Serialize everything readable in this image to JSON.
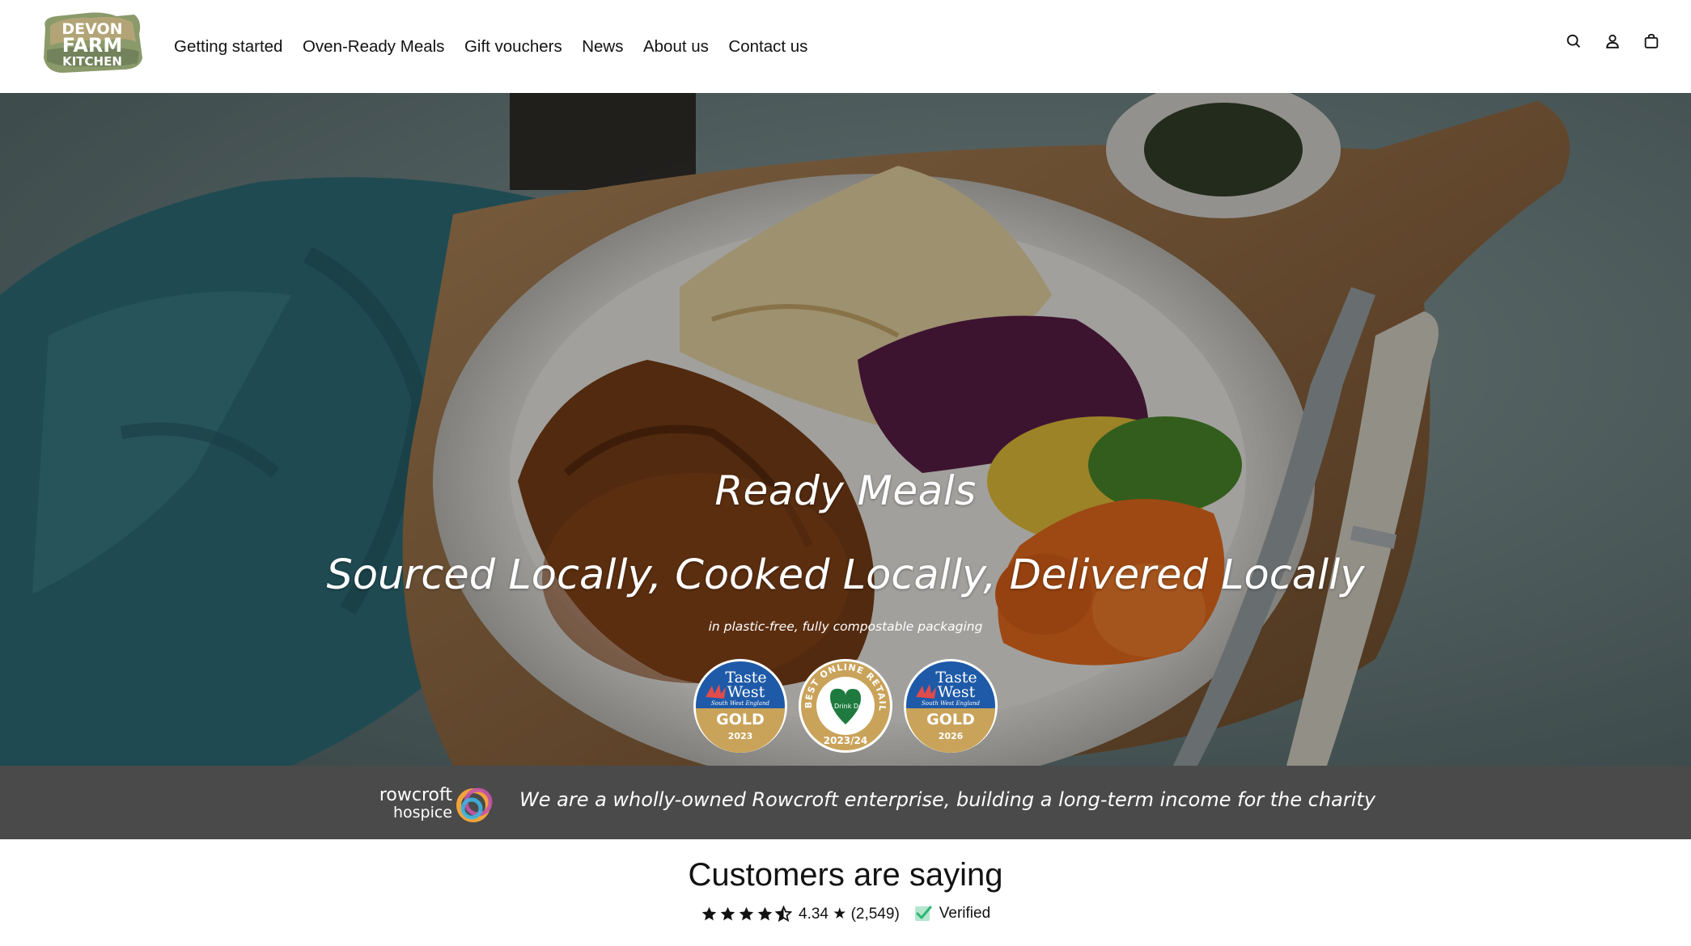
{
  "header": {
    "logo": {
      "line1": "DEVON",
      "line2": "FARM",
      "line3": "KITCHEN"
    },
    "nav": [
      {
        "label": "Getting started"
      },
      {
        "label": "Oven-Ready Meals"
      },
      {
        "label": "Gift vouchers"
      },
      {
        "label": "News"
      },
      {
        "label": "About us"
      },
      {
        "label": "Contact us"
      }
    ],
    "icons": [
      "search-icon",
      "account-icon",
      "cart-icon"
    ]
  },
  "hero": {
    "title": "Ready Meals",
    "subtitle": "Sourced Locally, Cooked Locally, Delivered Locally",
    "note": "in plastic-free, fully compostable packaging",
    "awards": [
      {
        "line1": "Taste",
        "line2": "West",
        "tagline": "South West England",
        "level": "GOLD",
        "year": "2023"
      },
      {
        "ring": "BEST ONLINE RETAILER",
        "inner": "Food Drink Devon",
        "year": "2023/24"
      },
      {
        "line1": "Taste",
        "line2": "West",
        "tagline": "South West England",
        "level": "GOLD",
        "year": "2026"
      }
    ]
  },
  "charity": {
    "logo_line1": "rowcroft",
    "logo_line2": "hospice",
    "text": "We are a wholly-owned Rowcroft enterprise, building a long-term income for the charity"
  },
  "reviews": {
    "title": "Customers are saying",
    "rating": 4.34,
    "rating_text": "4.34 ★ (2,549)",
    "verified_label": "Verified",
    "stars": [
      1,
      1,
      1,
      1,
      0.5
    ]
  },
  "colors": {
    "charity_strip": "#4a4a4a",
    "award_blue": "#1e5aa8",
    "award_gold": "#c9a35a",
    "verified_green": "#2bb673"
  }
}
